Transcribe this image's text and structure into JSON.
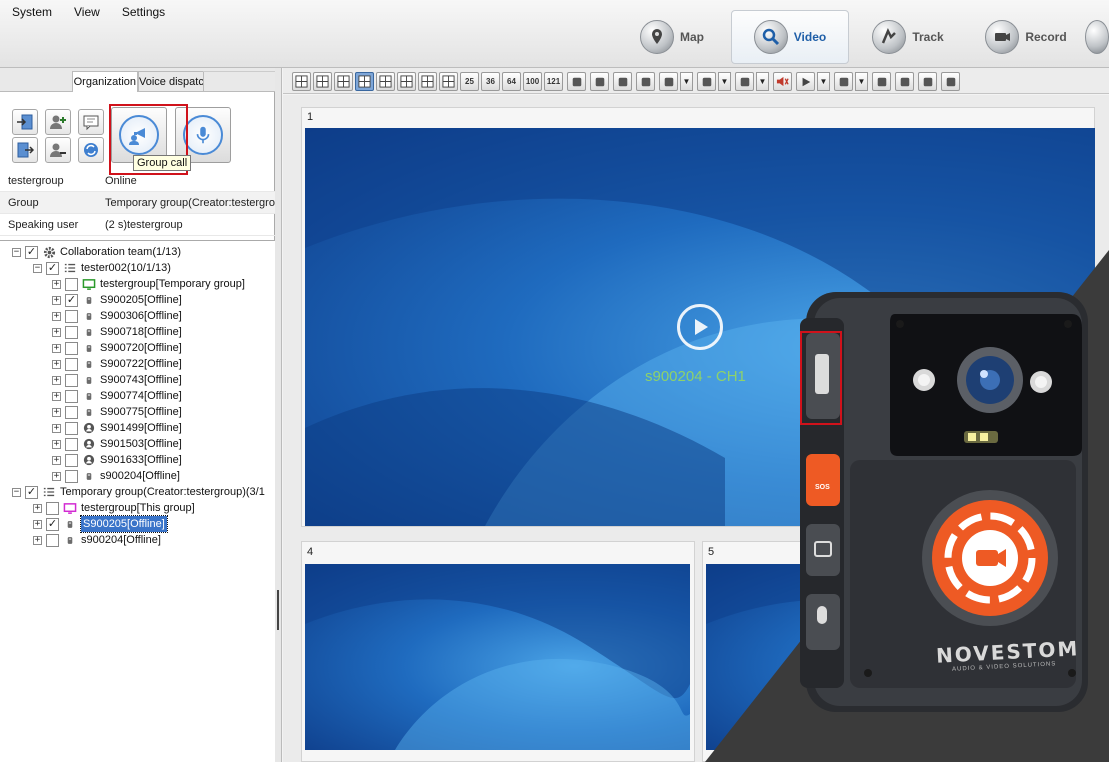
{
  "menu": [
    "System",
    "View",
    "Settings"
  ],
  "nav_tabs": [
    {
      "label": "Map",
      "icon": "map-pin-icon"
    },
    {
      "label": "Video",
      "icon": "magnifier-icon",
      "active": true
    },
    {
      "label": "Track",
      "icon": "track-icon"
    },
    {
      "label": "Record",
      "icon": "record-icon"
    }
  ],
  "left_tabs": {
    "organization": "Organization",
    "voice_dispatch": "Voice dispatch"
  },
  "group_call_tooltip": "Group call",
  "info": [
    {
      "key": "testergroup",
      "value": "Online"
    },
    {
      "key": "Group",
      "value": "Temporary group(Creator:testergroup)"
    },
    {
      "key": "Speaking user",
      "value": "(2 s)testergroup"
    }
  ],
  "tree": {
    "collaboration_team": "Collaboration team(1/13)",
    "tester002": "tester002(10/1/13)",
    "devices": [
      {
        "label": "testergroup[Temporary group]",
        "checked": false,
        "icon": "monitor-icon"
      },
      {
        "label": "S900205[Offline]",
        "checked": true,
        "icon": "device-icon"
      },
      {
        "label": "S900306[Offline]",
        "checked": false,
        "icon": "device-icon"
      },
      {
        "label": "S900718[Offline]",
        "checked": false,
        "icon": "device-icon"
      },
      {
        "label": "S900720[Offline]",
        "checked": false,
        "icon": "device-icon"
      },
      {
        "label": "S900722[Offline]",
        "checked": false,
        "icon": "device-icon"
      },
      {
        "label": "S900743[Offline]",
        "checked": false,
        "icon": "device-icon"
      },
      {
        "label": "S900774[Offline]",
        "checked": false,
        "icon": "device-icon"
      },
      {
        "label": "S900775[Offline]",
        "checked": false,
        "icon": "device-icon"
      },
      {
        "label": "S901499[Offline]",
        "checked": false,
        "icon": "user-icon"
      },
      {
        "label": "S901503[Offline]",
        "checked": false,
        "icon": "user-icon"
      },
      {
        "label": "S901633[Offline]",
        "checked": false,
        "icon": "user-icon"
      },
      {
        "label": "s900204[Offline]",
        "checked": false,
        "icon": "device-icon"
      }
    ],
    "temporary_group": "Temporary group(Creator:testergroup)(3/1",
    "temp_members": [
      {
        "label": "testergroup[This group]",
        "checked": false,
        "icon": "monitor-icon"
      },
      {
        "label": "S900205[Offline]",
        "checked": true,
        "icon": "device-icon",
        "selected": true
      },
      {
        "label": "s900204[Offline]",
        "checked": false,
        "icon": "device-icon"
      }
    ]
  },
  "toolbar": {
    "layout_numbers": [
      "25",
      "36",
      "64",
      "100",
      "121"
    ]
  },
  "video": {
    "window1_number": "1",
    "window1_channel": "s900204 - CH1",
    "window4_number": "4",
    "window5_number": "5"
  },
  "product": {
    "brand": "NOVESTOM",
    "tagline": "AUDIO & VIDEO SOLUTIONS",
    "sos_label": "SOS"
  },
  "colors": {
    "accent": "#1f5fa8",
    "highlight_red": "#d0121b",
    "channel_green": "#8ed26a",
    "camera_orange": "#ee5a24"
  }
}
